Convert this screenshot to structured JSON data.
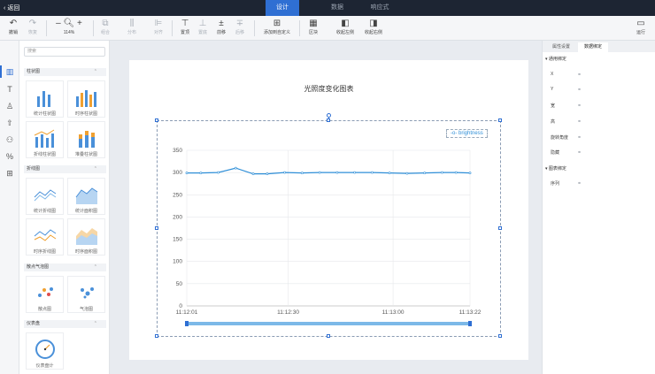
{
  "topbar": {
    "back_label": "返回",
    "tabs": [
      {
        "label": "设计",
        "active": true
      },
      {
        "label": "数据",
        "active": false
      },
      {
        "label": "响应式",
        "active": false
      }
    ]
  },
  "toolbar": {
    "undo": "撤销",
    "redo": "恢复",
    "zoom": "114%",
    "combine": "组合",
    "distribute": "分布",
    "align": "对齐",
    "top": "置顶",
    "bottom": "置底",
    "forward": "前移",
    "backward": "后移",
    "add_to_custom": "添加到自定义",
    "layout": "区块",
    "collapse_left": "收起左侧",
    "collapse_right": "收起右侧",
    "run": "运行"
  },
  "panel": {
    "search_placeholder": "搜索",
    "sections": [
      {
        "title": "柱状图",
        "items": [
          "统计柱状图",
          "时序柱状图",
          "折线柱状图",
          "堆叠柱状图"
        ]
      },
      {
        "title": "折线图",
        "items": [
          "统计折线图",
          "统计面积图",
          "时序折线图",
          "时序面积图"
        ]
      },
      {
        "title": "散点气泡图",
        "items": [
          "散点图",
          "气泡图"
        ]
      },
      {
        "title": "仪表盘",
        "items": [
          "仪表盘计"
        ]
      }
    ]
  },
  "chart_data": {
    "type": "line",
    "title": "光照度变化图表",
    "series": [
      {
        "name": "brightness",
        "color": "#2f8fd8",
        "x": [
          "11:12:01",
          "11:12:05",
          "11:12:10",
          "11:12:15",
          "11:12:20",
          "11:12:24",
          "11:12:29",
          "11:12:34",
          "11:12:39",
          "11:12:44",
          "11:12:49",
          "11:12:54",
          "11:12:59",
          "11:13:04",
          "11:13:09",
          "11:13:14",
          "11:13:18",
          "11:13:22"
        ],
        "values": [
          299,
          299,
          300,
          310,
          297,
          297,
          300,
          299,
          300,
          300,
          300,
          300,
          299,
          298,
          299,
          300,
          300,
          299
        ]
      }
    ],
    "x_ticks": [
      "11:12:01",
      "11:12:30",
      "11:13:00",
      "11:13:22"
    ],
    "y_ticks": [
      "0",
      "50",
      "100",
      "150",
      "200",
      "250",
      "300",
      "350"
    ],
    "ylim": [
      0,
      350
    ],
    "grid": true,
    "legend_position": "top-right",
    "datazoom": true
  },
  "rpanel": {
    "tabs": [
      {
        "label": "属性设置",
        "active": false
      },
      {
        "label": "数据绑定",
        "active": true
      }
    ],
    "general_section": "通用绑定",
    "general_props": [
      "X",
      "Y",
      "宽",
      "高",
      "旋转角度",
      "隐藏"
    ],
    "chart_section": "图表绑定",
    "chart_props": [
      "序列"
    ]
  }
}
